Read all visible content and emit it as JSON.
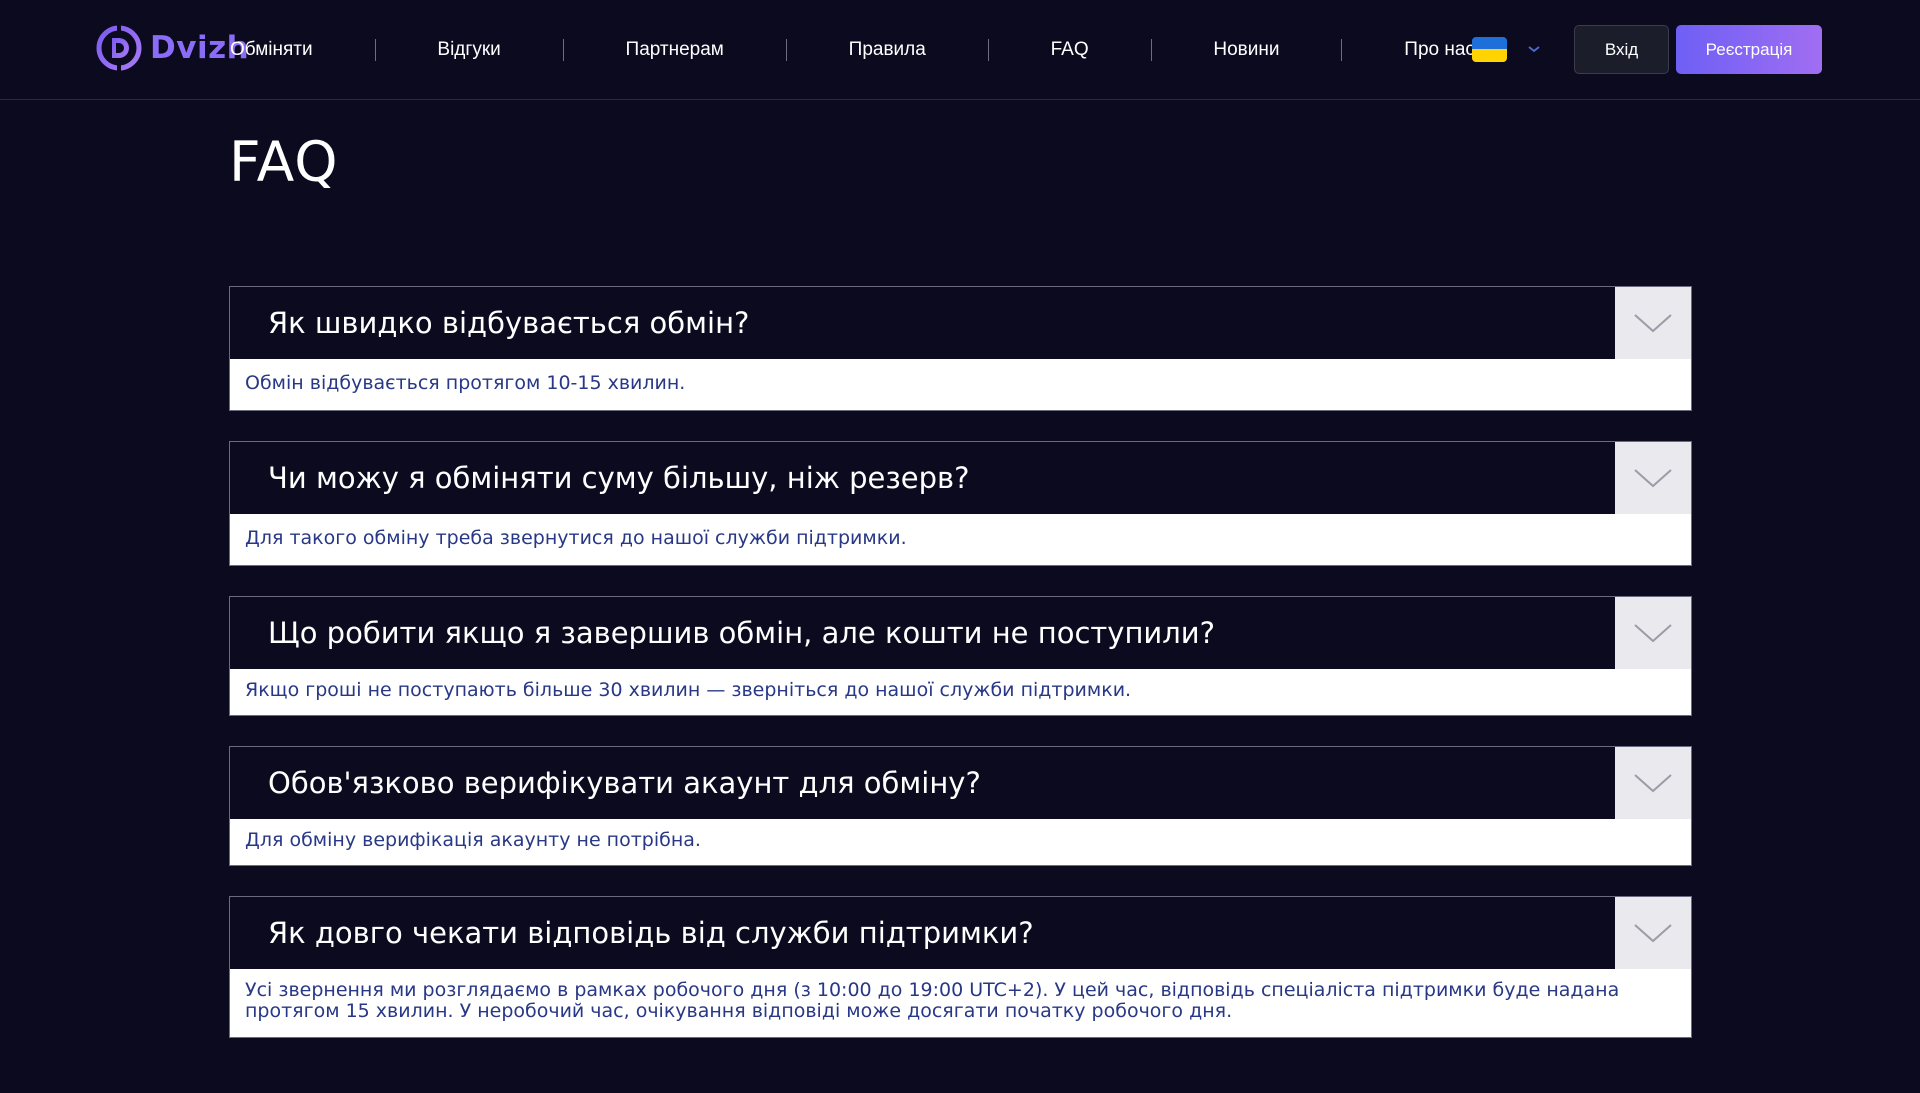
{
  "brand": {
    "name": "Dvizh",
    "logo_icon": "dvizh-logo-icon",
    "accent": "#8b6cf6"
  },
  "nav": {
    "items": [
      {
        "id": "exchange",
        "label": "Обміняти"
      },
      {
        "id": "reviews",
        "label": "Відгуки"
      },
      {
        "id": "partners",
        "label": "Партнерам"
      },
      {
        "id": "rules",
        "label": "Правила"
      },
      {
        "id": "faq",
        "label": "FAQ"
      },
      {
        "id": "news",
        "label": "Новини"
      },
      {
        "id": "about",
        "label": "Про нас"
      }
    ]
  },
  "language": {
    "flag_icon": "ukraine-flag-icon",
    "chevron_icon": "chevron-down-icon"
  },
  "auth": {
    "login_label": "Вхід",
    "register_label": "Реєстрація"
  },
  "page": {
    "title": "FAQ"
  },
  "faq": [
    {
      "question": "Як швидко відбувається обмін?",
      "answer": "Обмін відбувається протягом 10-15 хвилин."
    },
    {
      "question": "Чи можу я обміняти суму більшу, ніж резерв?",
      "answer": "Для такого обміну треба звернутися до нашої служби підтримки."
    },
    {
      "question": "Що робити якщо я завершив обмін, але кошти не поступили?",
      "answer": "Якщо гроші не поступають більше 30 хвилин — зверніться до нашої служби підтримки."
    },
    {
      "question": "Обов'язково верифікувати акаунт для обміну?",
      "answer": "Для обміну верифікація акаунту не потрібна."
    },
    {
      "question": "Як довго чекати відповідь від служби підтримки?",
      "answer": "Усі звернення ми розглядаємо в рамках робочого дня (з 10:00 до 19:00 UTC+2). У цей час, відповідь спеціаліста підтримки буде надана протягом 15 хвилин. У неробочий час, очікування відповіді може досягати початку робочого дня."
    }
  ]
}
